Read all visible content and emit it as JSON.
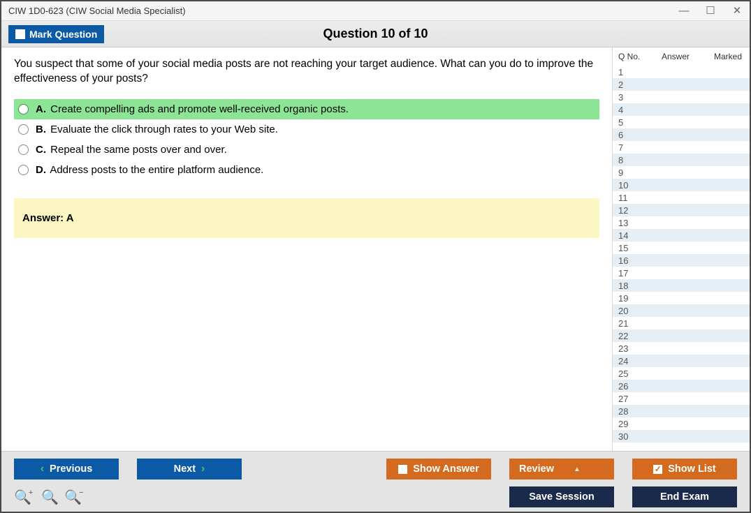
{
  "window": {
    "title": "CIW 1D0-623 (CIW Social Media Specialist)"
  },
  "header": {
    "mark_label": "Mark Question",
    "question_title": "Question 10 of 10"
  },
  "question": {
    "text": "You suspect that some of your social media posts are not reaching your target audience. What can you do to improve the effectiveness of your posts?",
    "options": [
      {
        "letter": "A.",
        "text": "Create compelling ads and promote well-received organic posts.",
        "selected": true
      },
      {
        "letter": "B.",
        "text": "Evaluate the click through rates to your Web site.",
        "selected": false
      },
      {
        "letter": "C.",
        "text": "Repeal the same posts over and over.",
        "selected": false
      },
      {
        "letter": "D.",
        "text": "Address posts to the entire platform audience.",
        "selected": false
      }
    ],
    "answer_label": "Answer: ",
    "answer_value": "A"
  },
  "qlist": {
    "col_qno": "Q No.",
    "col_answer": "Answer",
    "col_marked": "Marked",
    "rows": [
      1,
      2,
      3,
      4,
      5,
      6,
      7,
      8,
      9,
      10,
      11,
      12,
      13,
      14,
      15,
      16,
      17,
      18,
      19,
      20,
      21,
      22,
      23,
      24,
      25,
      26,
      27,
      28,
      29,
      30
    ]
  },
  "footer": {
    "previous": "Previous",
    "next": "Next",
    "show_answer": "Show Answer",
    "review": "Review",
    "show_list": "Show List",
    "save_session": "Save Session",
    "end_exam": "End Exam"
  },
  "icons": {
    "minimize": "—",
    "maximize": "☐",
    "close": "✕",
    "prev_chevron": "‹",
    "next_chevron": "›",
    "check": "✓",
    "review_caret": "▲"
  }
}
